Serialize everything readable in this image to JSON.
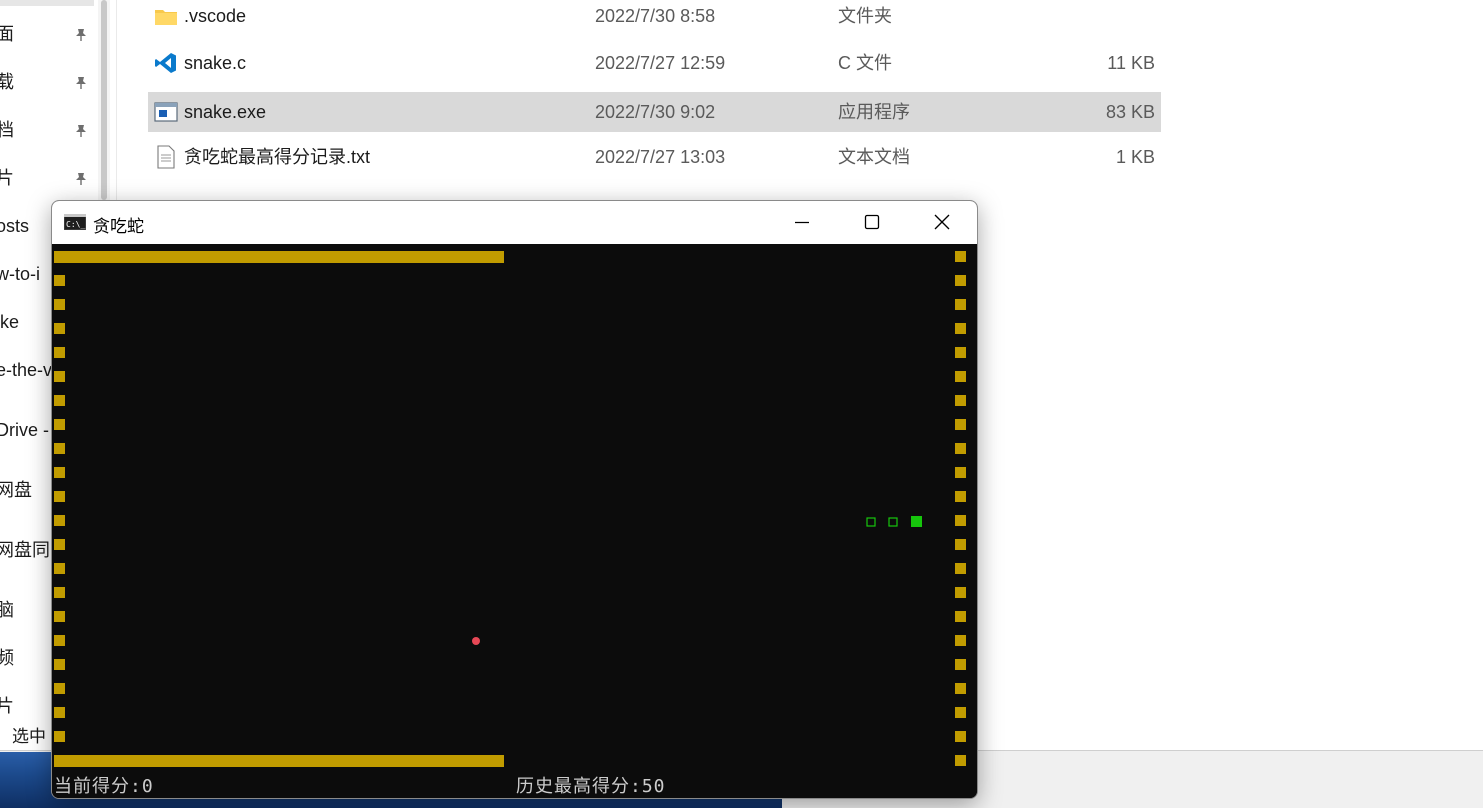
{
  "nav_pane": {
    "items": [
      {
        "label": "面",
        "pinned": true
      },
      {
        "label": "载",
        "pinned": true
      },
      {
        "label": "档",
        "pinned": true
      },
      {
        "label": "片",
        "pinned": true
      },
      {
        "label": "osts",
        "pinned": false
      },
      {
        "label": "w-to-i",
        "pinned": false
      },
      {
        "label": "ike",
        "pinned": false
      },
      {
        "label": "e-the-v",
        "pinned": false
      },
      {
        "label": "Drive -",
        "pinned": false
      },
      {
        "label": "网盘",
        "pinned": false
      },
      {
        "label": "网盘同",
        "pinned": false
      },
      {
        "label": "脑",
        "pinned": false
      },
      {
        "label": "频",
        "pinned": false
      },
      {
        "label": "片",
        "pinned": false
      }
    ],
    "status_text": "选中"
  },
  "files": [
    {
      "name": ".vscode",
      "date": "2022/7/30 8:58",
      "type": "文件夹",
      "size": "",
      "icon": "folder-icon",
      "selected": false
    },
    {
      "name": "snake.c",
      "date": "2022/7/27 12:59",
      "type": "C 文件",
      "size": "11 KB",
      "icon": "vscode-icon",
      "selected": false
    },
    {
      "name": "snake.exe",
      "date": "2022/7/30 9:02",
      "type": "应用程序",
      "size": "83 KB",
      "icon": "exe-icon",
      "selected": true
    },
    {
      "name": "贪吃蛇最高得分记录.txt",
      "date": "2022/7/27 13:03",
      "type": "文本文档",
      "size": "1 KB",
      "icon": "text-file-icon",
      "selected": false
    }
  ],
  "console": {
    "title": "贪吃蛇",
    "icon": "console-icon",
    "buttons": {
      "minimize": "minimize-icon",
      "maximize": "maximize-icon",
      "close": "close-icon"
    },
    "score_current": "当前得分:0",
    "score_best": "历史最高得分:50"
  },
  "colors": {
    "wall": "#c19c00",
    "snake": "#16c60c",
    "food": "#e74856",
    "console_bg": "#0c0c0c",
    "selected_row": "#d9d9d9"
  }
}
